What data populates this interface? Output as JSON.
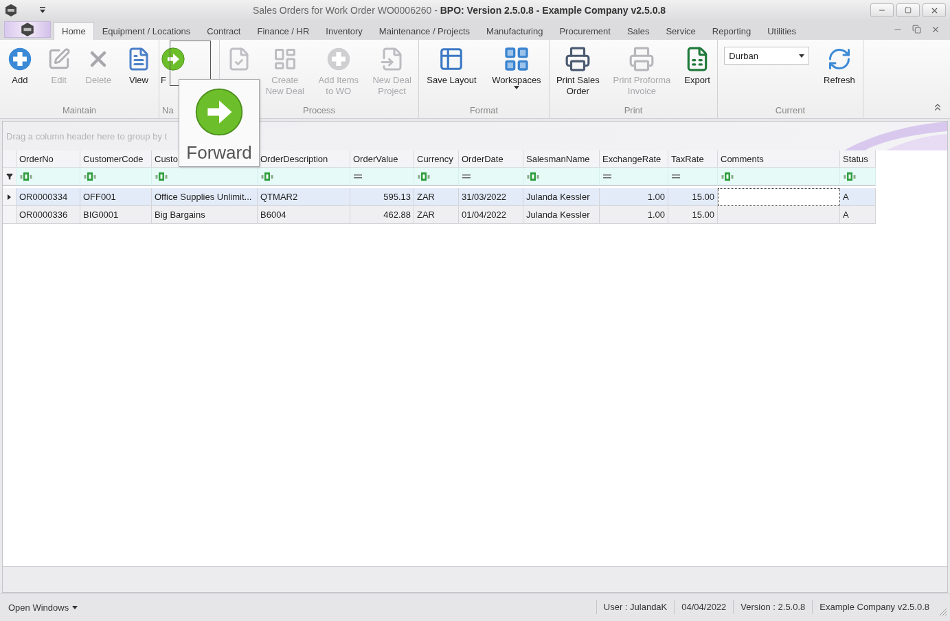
{
  "window": {
    "title": "Sales Orders for Work Order WO0006260 - **BPO: Version 2.5.0.8 - Example Company v2.5.0.8**"
  },
  "tabs": [
    {
      "label": "Home",
      "selected": true
    },
    {
      "label": "Equipment / Locations",
      "selected": false
    },
    {
      "label": "Contract",
      "selected": false
    },
    {
      "label": "Finance / HR",
      "selected": false
    },
    {
      "label": "Inventory",
      "selected": false
    },
    {
      "label": "Maintenance / Projects",
      "selected": false
    },
    {
      "label": "Manufacturing",
      "selected": false
    },
    {
      "label": "Procurement",
      "selected": false
    },
    {
      "label": "Sales",
      "selected": false
    },
    {
      "label": "Service",
      "selected": false
    },
    {
      "label": "Reporting",
      "selected": false
    },
    {
      "label": "Utilities",
      "selected": false
    }
  ],
  "ribbon": {
    "groups": [
      {
        "label": "Maintain",
        "buttons": [
          {
            "lines": [
              "Add"
            ],
            "disabled": false
          },
          {
            "lines": [
              "Edit"
            ],
            "disabled": true
          },
          {
            "lines": [
              "Delete"
            ],
            "disabled": true
          },
          {
            "lines": [
              "View"
            ],
            "disabled": false
          }
        ]
      },
      {
        "label": "Na",
        "buttons": [
          {
            "lines": [
              "F"
            ],
            "disabled": false
          }
        ]
      },
      {
        "label": "Process",
        "buttons": [
          {
            "disabled": true
          },
          {
            "lines": [
              "Create",
              "New Deal"
            ],
            "disabled": true
          },
          {
            "lines": [
              "Add Items",
              "to WO"
            ],
            "disabled": true
          },
          {
            "lines": [
              "New Deal",
              "Project"
            ],
            "disabled": true
          }
        ]
      },
      {
        "label": "Format",
        "buttons": [
          {
            "lines": [
              "Save Layout"
            ],
            "disabled": false
          },
          {
            "lines": [
              "Workspaces"
            ],
            "disabled": false
          }
        ]
      },
      {
        "label": "Print",
        "buttons": [
          {
            "lines": [
              "Print Sales",
              "Order"
            ],
            "disabled": false
          },
          {
            "lines": [
              "Print Proforma",
              "Invoice"
            ],
            "disabled": true
          },
          {
            "lines": [
              "Export"
            ],
            "disabled": false
          }
        ]
      },
      {
        "label": "Current",
        "combo": "Durban",
        "buttons": [
          {
            "lines": [
              "Refresh"
            ],
            "disabled": false
          }
        ]
      }
    ]
  },
  "tooltip": {
    "text": "Forward"
  },
  "grid": {
    "group_panel": "Drag a column header here to group by t",
    "columns": [
      {
        "label": "OrderNo",
        "kind": "text"
      },
      {
        "label": "CustomerCode",
        "kind": "text"
      },
      {
        "label": "Custo",
        "kind": "text"
      },
      {
        "label": "OrderDescription",
        "kind": "text"
      },
      {
        "label": "OrderValue",
        "kind": "number"
      },
      {
        "label": "Currency",
        "kind": "text"
      },
      {
        "label": "OrderDate",
        "kind": "date"
      },
      {
        "label": "SalesmanName",
        "kind": "text"
      },
      {
        "label": "ExchangeRate",
        "kind": "number"
      },
      {
        "label": "TaxRate",
        "kind": "number"
      },
      {
        "label": "Comments",
        "kind": "text"
      },
      {
        "label": "Status",
        "kind": "text"
      }
    ],
    "rows": [
      {
        "selected": true,
        "cells": [
          "OR0000334",
          "OFF001",
          "Office Supplies Unlimit...",
          "QTMAR2",
          "595.13",
          "ZAR",
          "31/03/2022",
          "Julanda Kessler",
          "1.00",
          "15.00",
          {
            "focused": true
          },
          "A"
        ]
      },
      {
        "selected": false,
        "cells": [
          "OR0000336",
          "BIG0001",
          "Big Bargains",
          "B6004",
          "462.88",
          "ZAR",
          "01/04/2022",
          "Julanda Kessler",
          "1.00",
          "15.00",
          {
            "focused": false
          },
          "A"
        ]
      }
    ]
  },
  "status_bar": {
    "menu": "Open Windows",
    "items": [
      "User : JulandaK",
      "04/04/2022",
      "Version : 2.5.0.8",
      "Example Company v2.5.0.8"
    ]
  }
}
